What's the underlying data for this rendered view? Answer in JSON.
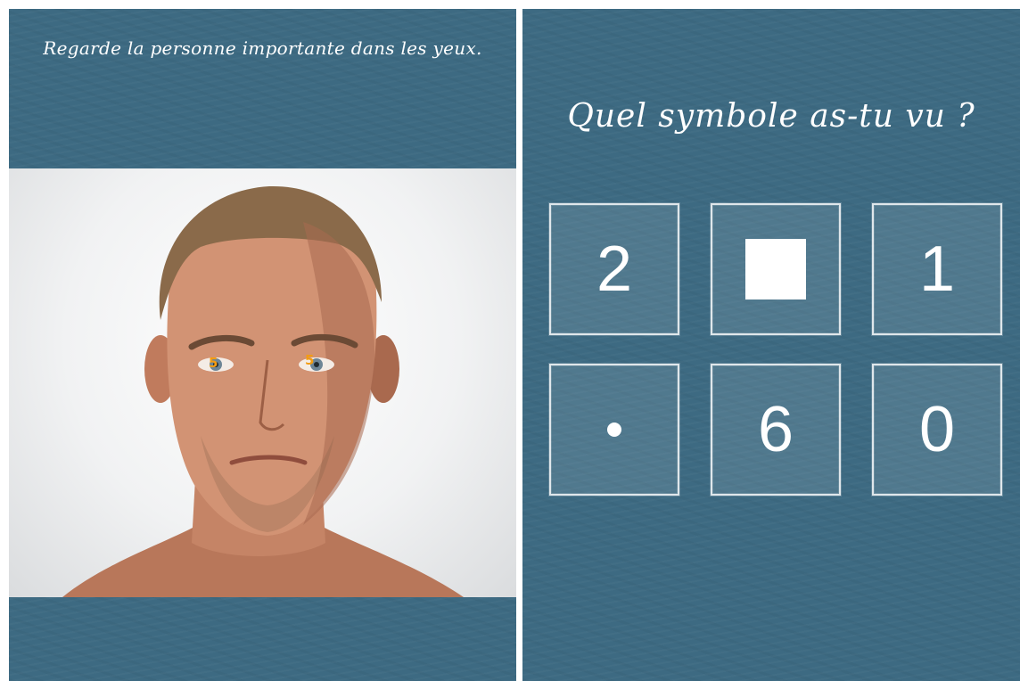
{
  "left_screen": {
    "instruction": "Regarde la personne importante dans les yeux.",
    "eye_markers": [
      "5",
      "5"
    ]
  },
  "right_screen": {
    "question": "Quel symbole as-tu vu ?",
    "choices": [
      {
        "label": "2",
        "kind": "text"
      },
      {
        "label": "",
        "kind": "square"
      },
      {
        "label": "1",
        "kind": "text"
      },
      {
        "label": "",
        "kind": "dot"
      },
      {
        "label": "6",
        "kind": "text"
      },
      {
        "label": "0",
        "kind": "text"
      }
    ]
  },
  "colors": {
    "chalkboard": "#3d6a82",
    "marker": "#f39c12",
    "text": "#ffffff"
  }
}
